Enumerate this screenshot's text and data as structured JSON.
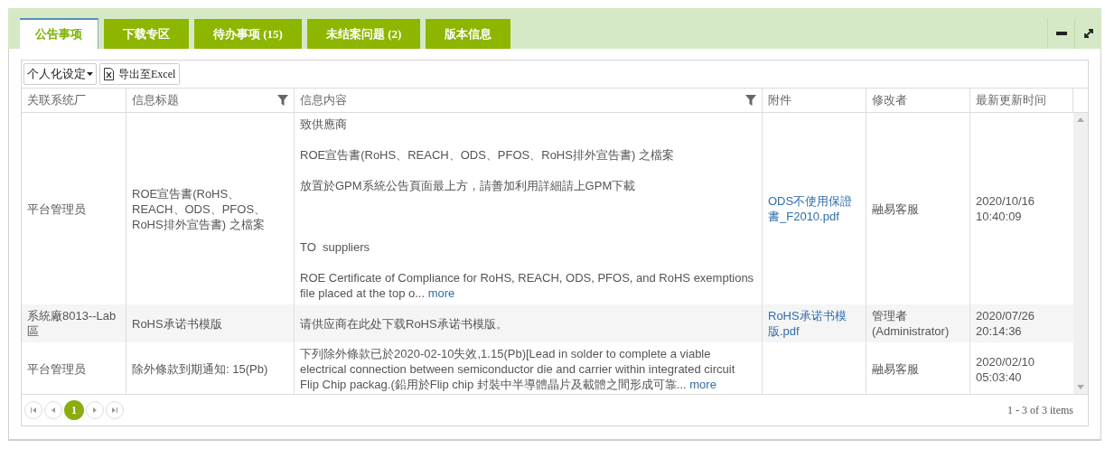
{
  "tabs": [
    {
      "label": "公告事项",
      "selected": true
    },
    {
      "label": "下载专区",
      "selected": false
    },
    {
      "label": "待办事项 (15)",
      "selected": false
    },
    {
      "label": "未结案问题 (2)",
      "selected": false
    },
    {
      "label": "版本信息",
      "selected": false
    }
  ],
  "toolbar": {
    "settings_menu": "个人化设定",
    "export_button": "导出至Excel"
  },
  "table": {
    "columns": [
      {
        "label": "关联系统厂",
        "filterable": false
      },
      {
        "label": "信息标题",
        "filterable": true
      },
      {
        "label": "信息内容",
        "filterable": true
      },
      {
        "label": "附件",
        "filterable": false
      },
      {
        "label": "修改者",
        "filterable": false
      },
      {
        "label": "最新更新时间",
        "filterable": false
      }
    ],
    "rows": [
      {
        "factory": "平台管理员",
        "title": "ROE宣告書(RoHS、REACH、ODS、PFOS、RoHS排外宣告書) 之檔案",
        "content": {
          "blocks": [
            [
              "致供應商",
              "ROE宣告書(RoHS、REACH、ODS、PFOS、RoHS排外宣告書) 之檔案",
              "放置於GPM系統公告頁面最上方，請善加利用詳細請上GPM下載"
            ],
            [
              "TO  suppliers",
              "ROE Certificate of Compliance for RoHS, REACH, ODS, PFOS, and RoHS exemptions file placed at the top o..."
            ]
          ],
          "more": "more"
        },
        "attachment": "ODS不使用保證書_F2010.pdf",
        "modifier": "融易客服",
        "updated": "2020/10/16 10:40:09"
      },
      {
        "factory": "系統廠8013--Lab區",
        "title": "RoHS承诺书模版",
        "content": {
          "blocks": [
            [
              "请供应商在此处下载RoHS承诺书模版。"
            ]
          ]
        },
        "attachment": "RoHS承诺书模版.pdf",
        "modifier": "管理者(Administrator)",
        "updated": "2020/07/26 20:14:36"
      },
      {
        "factory": "平台管理员",
        "title": "除外條款到期通知: 15(Pb)",
        "content": {
          "blocks": [
            [
              "下列除外條款已於2020-02-10失效,1.15(Pb)[Lead in solder to complete a viable electrical connection between semiconductor die and carrier within integrated circuit Flip Chip packag.(鉛用於Flip chip 封裝中半導體晶片及載體之間形成可靠..."
            ]
          ],
          "more": "more"
        },
        "modifier": "融易客服",
        "updated": "2020/02/10 05:03:40"
      }
    ]
  },
  "pager": {
    "pages": [
      {
        "label": "1",
        "selected": true
      }
    ],
    "summary": "1 - 3 of 3 items"
  }
}
